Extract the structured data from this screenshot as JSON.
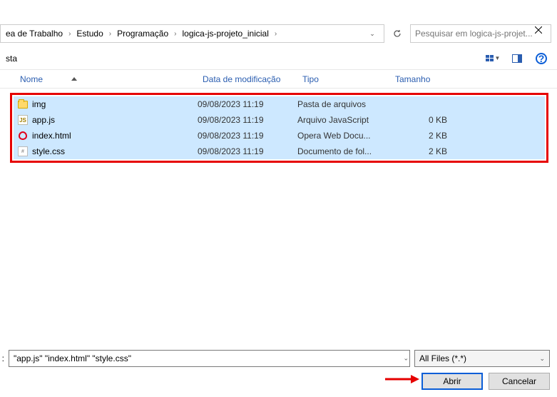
{
  "breadcrumbs": [
    "ea de Trabalho",
    "Estudo",
    "Programação",
    "logica-js-projeto_inicial"
  ],
  "search": {
    "placeholder": "Pesquisar em logica-js-projet..."
  },
  "toolbar_left_label": "sta",
  "columns": {
    "name": "Nome",
    "date": "Data de modificação",
    "type": "Tipo",
    "size": "Tamanho"
  },
  "files": [
    {
      "icon": "folder",
      "name": "img",
      "date": "09/08/2023 11:19",
      "type": "Pasta de arquivos",
      "size": ""
    },
    {
      "icon": "js",
      "name": "app.js",
      "date": "09/08/2023 11:19",
      "type": "Arquivo JavaScript",
      "size": "0 KB"
    },
    {
      "icon": "opera",
      "name": "index.html",
      "date": "09/08/2023 11:19",
      "type": "Opera Web Docu...",
      "size": "2 KB"
    },
    {
      "icon": "css",
      "name": "style.css",
      "date": "09/08/2023 11:19",
      "type": "Documento de fol...",
      "size": "2 KB"
    }
  ],
  "filename_value": "\"app.js\" \"index.html\" \"style.css\"",
  "filter_label": "All Files (*.*)",
  "buttons": {
    "open": "Abrir",
    "cancel": "Cancelar"
  }
}
